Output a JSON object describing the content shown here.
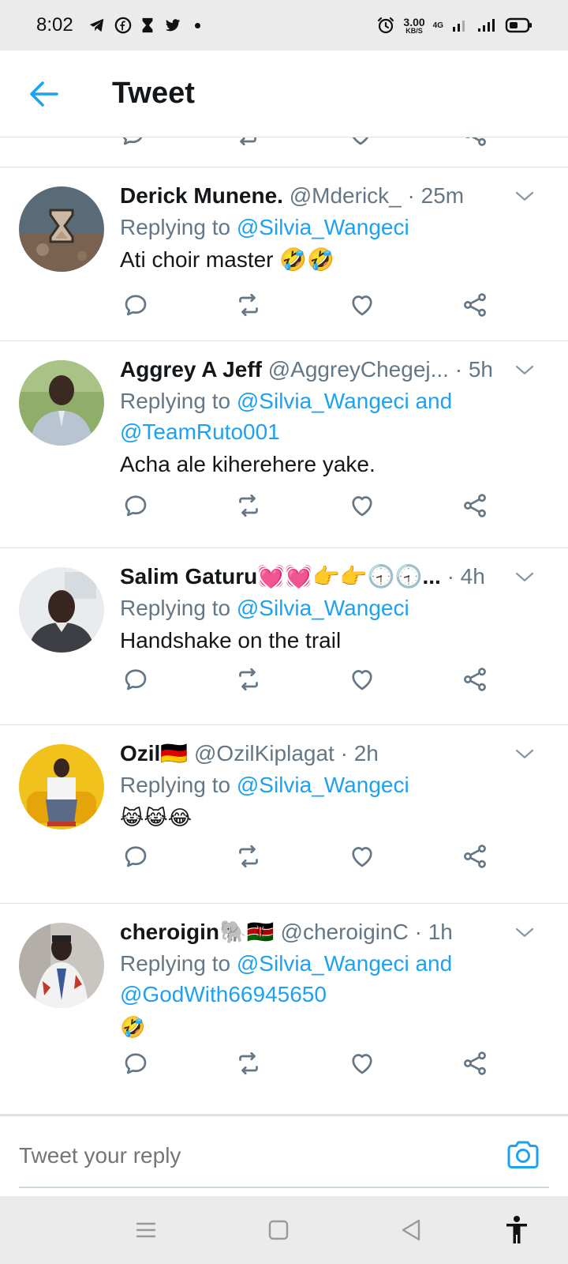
{
  "status_bar": {
    "time": "8:02",
    "speed_value": "3.00",
    "speed_unit": "KB/S",
    "network": "4G"
  },
  "header": {
    "title": "Tweet"
  },
  "tweets": [
    {
      "name": "Derick Munene.",
      "handle": "@Mderick_",
      "time": "· 25m",
      "reply_prefix": "Replying to",
      "mentions": "@Silvia_Wangeci",
      "mentions2": "",
      "text": "Ati choir master 🤣🤣"
    },
    {
      "name": "Aggrey A Jeff",
      "handle": "@AggreyChegej...",
      "time": "· 5h",
      "reply_prefix": "Replying to",
      "mentions": "@Silvia_Wangeci and",
      "mentions2": "@TeamRuto001",
      "text": "Acha ale kiherehere yake."
    },
    {
      "name": "Salim Gaturu💓💓👉👉🕣🕣...",
      "handle": "",
      "time": "· 4h",
      "reply_prefix": "Replying to",
      "mentions": "@Silvia_Wangeci",
      "mentions2": "",
      "text": "Handshake on the trail"
    },
    {
      "name": "Ozil🇩🇪",
      "handle": "@OzilKiplagat",
      "time": "· 2h",
      "reply_prefix": "Replying to",
      "mentions": "@Silvia_Wangeci",
      "mentions2": "",
      "text": "😹😹😂"
    },
    {
      "name": "cheroigin🐘🇰🇪",
      "handle": "@cheroiginC",
      "time": "· 1h",
      "reply_prefix": "Replying to",
      "mentions": "@Silvia_Wangeci and",
      "mentions2": "@GodWith66945650",
      "text": "🤣"
    }
  ],
  "reply": {
    "placeholder": "Tweet your reply"
  },
  "colors": {
    "accent": "#1da1f2",
    "muted": "#657786",
    "text": "#14171a",
    "divider": "#dfe3e6"
  },
  "icons": [
    "back-arrow-icon",
    "reply-icon",
    "retweet-icon",
    "like-icon",
    "share-icon",
    "chevron-down-icon",
    "camera-icon",
    "menu-icon",
    "home-square-icon",
    "back-triangle-icon",
    "accessibility-icon"
  ]
}
